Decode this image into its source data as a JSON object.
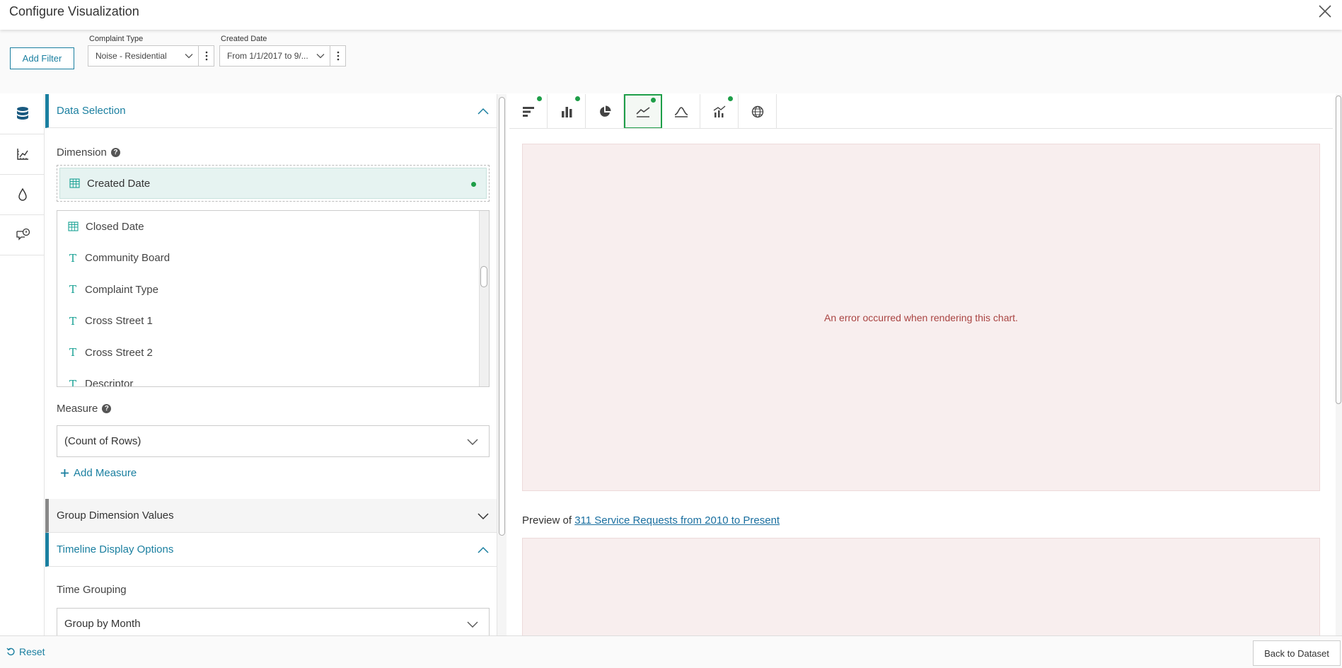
{
  "header": {
    "title": "Configure Visualization"
  },
  "filters": {
    "add_filter_label": "Add Filter",
    "items": [
      {
        "label": "Complaint Type",
        "value": "Noise - Residential"
      },
      {
        "label": "Created Date",
        "value": "From 1/1/2017 to 9/..."
      }
    ]
  },
  "sections": {
    "data_selection": "Data Selection",
    "group_dimension": "Group Dimension Values",
    "timeline_options": "Timeline Display Options"
  },
  "dimension": {
    "label": "Dimension",
    "selected": "Created Date",
    "columns": [
      {
        "name": "Closed Date",
        "type": "date"
      },
      {
        "name": "Community Board",
        "type": "text"
      },
      {
        "name": "Complaint Type",
        "type": "text"
      },
      {
        "name": "Cross Street 1",
        "type": "text"
      },
      {
        "name": "Cross Street 2",
        "type": "text"
      },
      {
        "name": "Descriptor",
        "type": "text"
      }
    ]
  },
  "measure": {
    "label": "Measure",
    "value": "(Count of Rows)",
    "add_label": "Add Measure"
  },
  "timeline": {
    "time_grouping_label": "Time Grouping",
    "time_grouping_value": "Group by Month"
  },
  "preview": {
    "error_message": "An error occurred when rendering this chart.",
    "caption_prefix": "Preview of",
    "dataset_link": "311 Service Requests from 2010 to Present"
  },
  "footer": {
    "reset_label": "Reset",
    "back_label": "Back to Dataset"
  },
  "colors": {
    "accent": "#1a7fa0",
    "green": "#1e9e48",
    "teal_icon": "#1aa295",
    "error_bg": "#f8eeee",
    "error_text": "#a94442"
  }
}
